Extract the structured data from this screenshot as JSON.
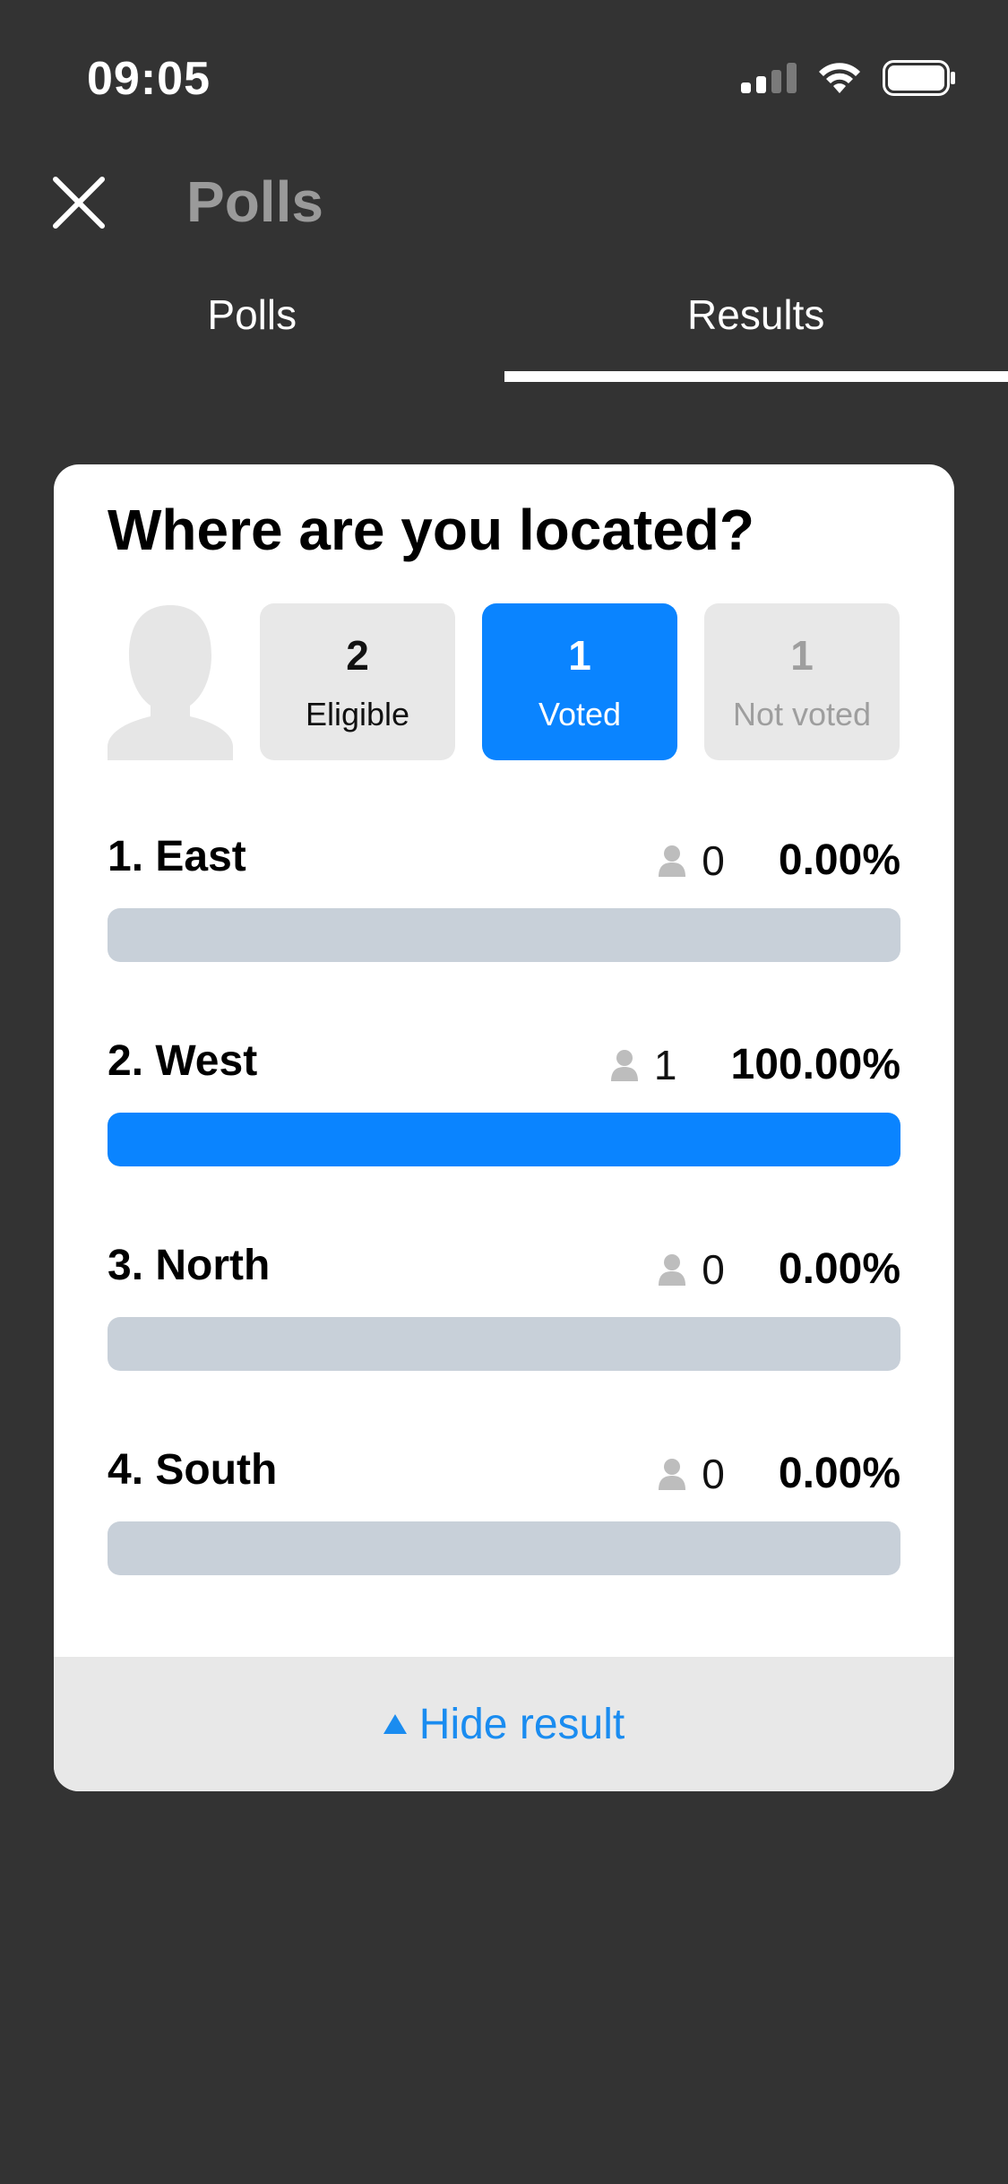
{
  "status_bar": {
    "time": "09:05"
  },
  "header": {
    "title": "Polls"
  },
  "tabs": [
    {
      "label": "Polls",
      "active": false
    },
    {
      "label": "Results",
      "active": true
    }
  ],
  "poll": {
    "question": "Where are you located?",
    "stats": {
      "eligible": {
        "count": "2",
        "label": "Eligible"
      },
      "voted": {
        "count": "1",
        "label": "Voted"
      },
      "not_voted": {
        "count": "1",
        "label": "Not voted"
      }
    },
    "options": [
      {
        "label": "1. East",
        "votes": "0",
        "percent": "0.00%",
        "share": 0
      },
      {
        "label": "2. West",
        "votes": "1",
        "percent": "100.00%",
        "share": 1
      },
      {
        "label": "3. North",
        "votes": "0",
        "percent": "0.00%",
        "share": 0
      },
      {
        "label": "4. South",
        "votes": "0",
        "percent": "0.00%",
        "share": 0
      }
    ],
    "footer_label": "Hide result"
  },
  "colors": {
    "accent": "#0a84ff",
    "background": "#333333",
    "bar_track": "#c8d0d9",
    "link": "#1a8cf0"
  }
}
